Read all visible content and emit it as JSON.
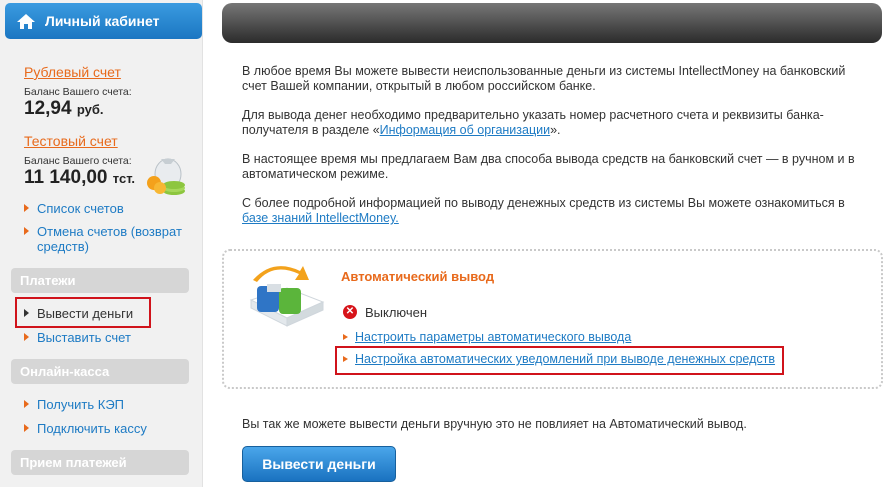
{
  "sidebar": {
    "header_title": "Личный кабинет",
    "ruble_account": {
      "title": "Рублевый счет",
      "balance_caption": "Баланс Вашего счета:",
      "balance_value": "12,94",
      "currency": "руб."
    },
    "test_account": {
      "title": "Тестовый счет",
      "balance_caption": "Баланс Вашего счета:",
      "balance_value": "11 140,00",
      "currency": "тст."
    },
    "links": [
      "Список счетов",
      "Отмена счетов (возврат средств)"
    ],
    "sections": {
      "payments": {
        "title": "Платежи",
        "items": [
          "Вывести деньги",
          "Выставить счет"
        ]
      },
      "online_cashier": {
        "title": "Онлайн-касса",
        "items": [
          "Получить КЭП",
          "Подключить кассу"
        ]
      },
      "accept_payments": {
        "title": "Прием платежей"
      }
    }
  },
  "main": {
    "p1": "В любое время Вы можете вывести неиспользованные деньги из системы IntellectMoney на банковский счет Вашей компании, открытый в любом российском банке.",
    "p2_before": "Для вывода денег необходимо предварительно указать номер расчетного счета и реквизиты банка-получателя в разделе «",
    "p2_link": "Информация об организации",
    "p2_after": "».",
    "p3": "В настоящее время мы предлагаем Вам два способа вывода средств на банковский счет — в ручном и в автоматическом режиме.",
    "p4_before": "С более подробной информацией по выводу денежных средств из системы Вы можете ознакомиться в ",
    "p4_link": "базе знаний IntellectMoney.",
    "auto": {
      "title": "Автоматический вывод",
      "status": "Выключен",
      "link1": "Настроить параметры автоматического вывода",
      "link2": "Настройка автоматических уведомлений при выводе денежных средств"
    },
    "note": "Вы так же можете вывести деньги вручную это не повлияет на Автоматический вывод.",
    "withdraw_button": "Вывести деньги"
  },
  "colors": {
    "accent_orange": "#e86a1c",
    "link_blue": "#1e7bc4",
    "highlight_red": "#d0131b",
    "status_red": "#d7141a"
  }
}
